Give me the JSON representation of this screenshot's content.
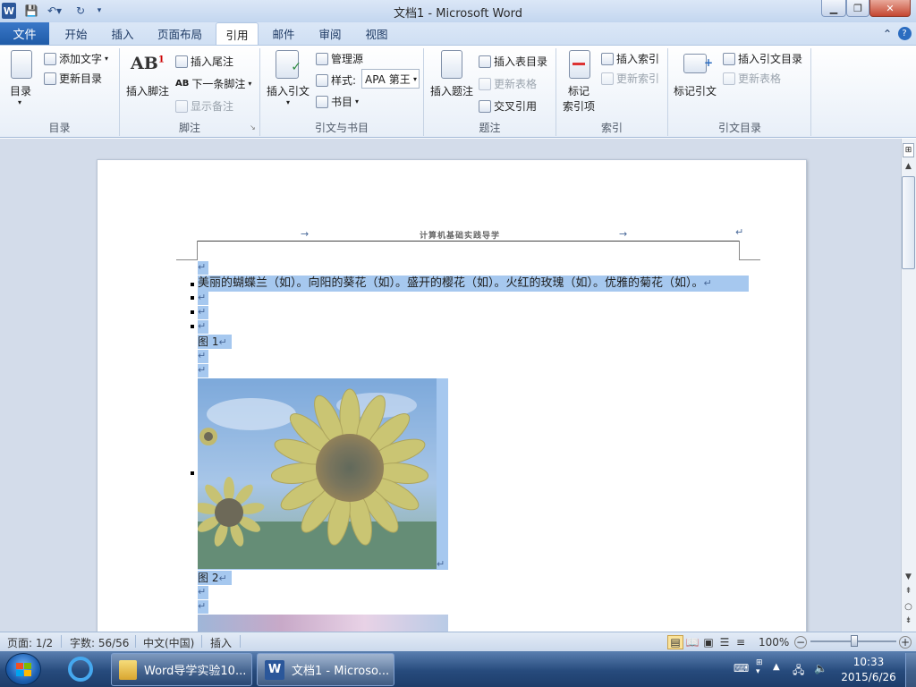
{
  "titlebar": {
    "title": "文档1 - Microsoft Word"
  },
  "tabs": {
    "file": "文件",
    "items": [
      "开始",
      "插入",
      "页面布局",
      "引用",
      "邮件",
      "审阅",
      "视图"
    ]
  },
  "ribbon": {
    "toc": {
      "toc_button": "目录",
      "add_text": "添加文字",
      "update_toc": "更新目录",
      "group": "目录"
    },
    "footnotes": {
      "insert_footnote": "插入脚注",
      "insert_endnote": "插入尾注",
      "next_footnote": "下一条脚注",
      "show_notes": "显示备注",
      "group": "脚注"
    },
    "citations": {
      "insert_citation": "插入引文",
      "manage_sources": "管理源",
      "style_label": "样式:",
      "style_value": "APA 第王",
      "bibliography": "书目",
      "group": "引文与书目"
    },
    "captions": {
      "insert_caption": "插入题注",
      "insert_table_of_figures": "插入表目录",
      "update_table": "更新表格",
      "cross_reference": "交叉引用",
      "group": "题注"
    },
    "index": {
      "mark_entry_line1": "标记",
      "mark_entry_line2": "索引项",
      "insert_index": "插入索引",
      "update_index": "更新索引",
      "group": "索引"
    },
    "toa": {
      "mark_citation": "标记引文",
      "insert_toa": "插入引文目录",
      "update_table": "更新表格",
      "group": "引文目录"
    }
  },
  "document": {
    "header_text": "计算机基础实践导学",
    "body_line": "美丽的蝴蝶兰（如）。向阳的葵花（如）。盛开的樱花（如）。火红的玫瑰（如）。优雅的菊花（如）。",
    "caption1": "图 1",
    "caption2": "图 2",
    "para_mark": "↵",
    "tab_mark": "→"
  },
  "statusbar": {
    "page": "页面: 1/2",
    "words": "字数: 56/56",
    "language": "中文(中国)",
    "mode": "插入",
    "zoom": "100%"
  },
  "taskbar": {
    "task1": "Word导学实验10...",
    "task2": "文档1 - Microso...",
    "time": "10:33",
    "date": "2015/6/26"
  },
  "colors": {
    "selection": "#a6c8ef",
    "ribbon_accent": "#2b579a",
    "file_tab": "#2b6cc0"
  }
}
